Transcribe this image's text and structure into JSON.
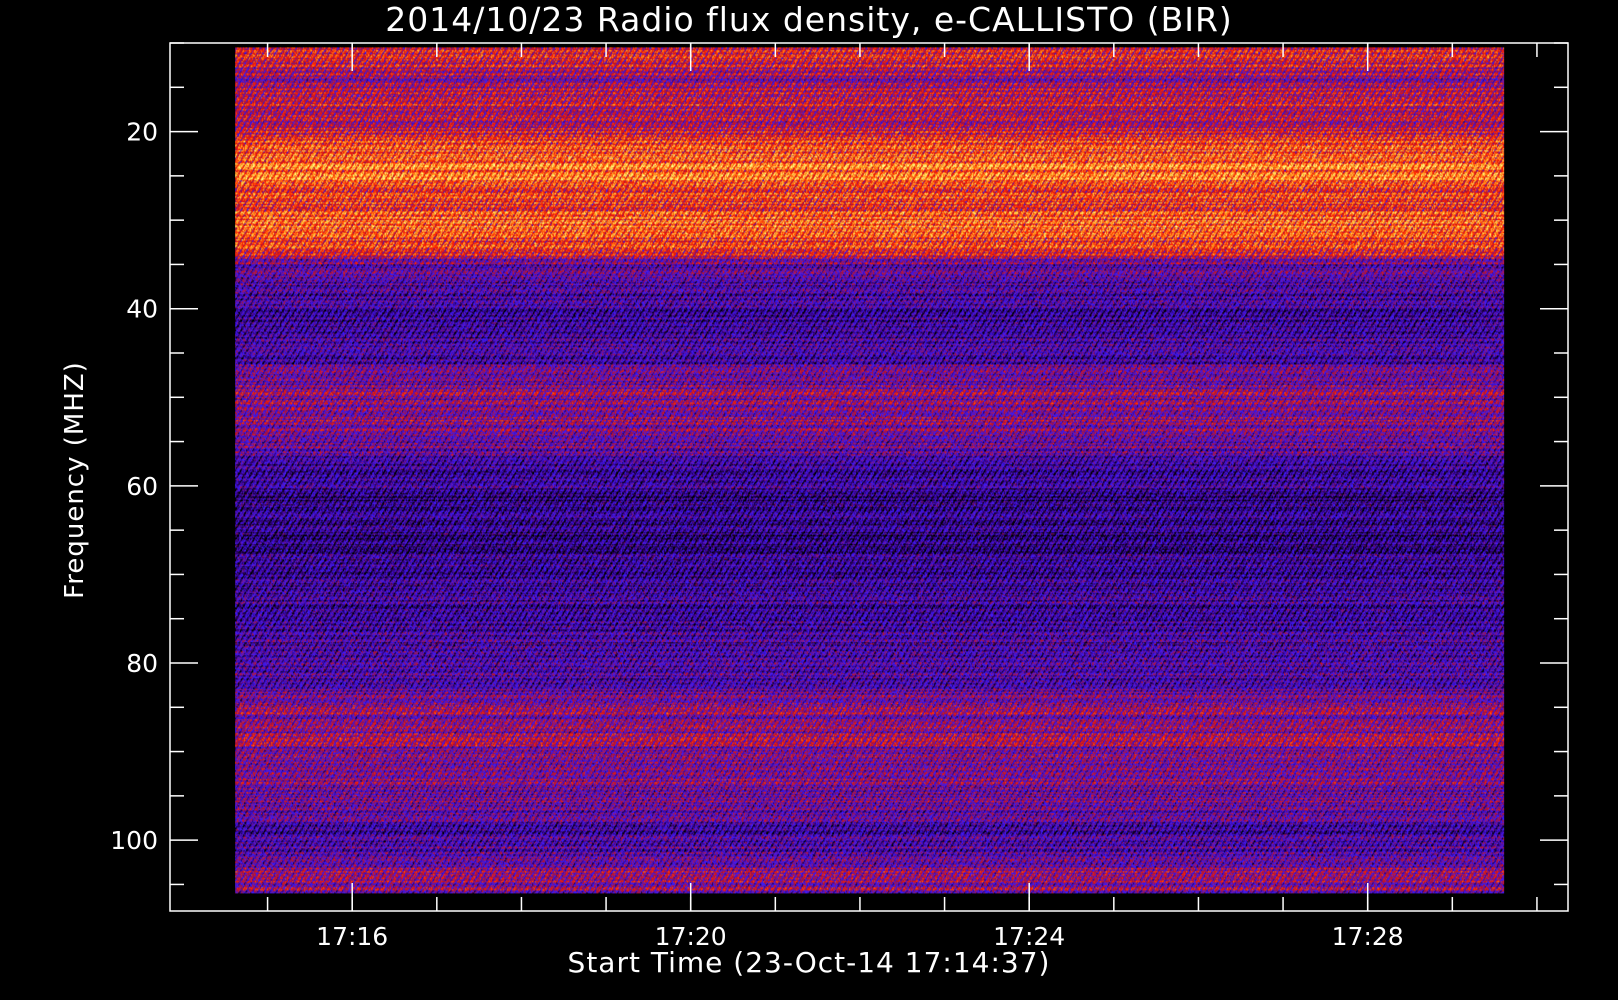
{
  "chart_data": {
    "type": "heatmap",
    "title": "2014/10/23  Radio flux density, e-CALLISTO (BIR)",
    "xlabel": "Start Time (23-Oct-14 17:14:37)",
    "ylabel": "Frequency (MHZ)",
    "x_tick_labels": [
      "17:16",
      "17:20",
      "17:24",
      "17:28"
    ],
    "x_tick_minutes": [
      1.383,
      5.383,
      9.383,
      13.383
    ],
    "x_range_minutes_from_start": [
      -0.77,
      15.75
    ],
    "data_time_range_minutes_from_start": [
      0.0,
      15.0
    ],
    "y_tick_values": [
      20,
      40,
      60,
      80,
      100
    ],
    "y_range": [
      10,
      108
    ],
    "y_reversed": true,
    "data_freq_range": [
      10.5,
      106
    ],
    "colormap": [
      "#000000",
      "#3a0080",
      "#3a1cff",
      "#a01040",
      "#ff2000",
      "#ffa020",
      "#ffff80"
    ],
    "intensity_profile": [
      {
        "freq": 10,
        "level": 0.55
      },
      {
        "freq": 12,
        "level": 0.6
      },
      {
        "freq": 14,
        "level": 0.45
      },
      {
        "freq": 17,
        "level": 0.6
      },
      {
        "freq": 19,
        "level": 0.5
      },
      {
        "freq": 22,
        "level": 0.72
      },
      {
        "freq": 25,
        "level": 0.78
      },
      {
        "freq": 27,
        "level": 0.65
      },
      {
        "freq": 30,
        "level": 0.75
      },
      {
        "freq": 33,
        "level": 0.7
      },
      {
        "freq": 35,
        "level": 0.35
      },
      {
        "freq": 38,
        "level": 0.28
      },
      {
        "freq": 42,
        "level": 0.25
      },
      {
        "freq": 46,
        "level": 0.3
      },
      {
        "freq": 49,
        "level": 0.45
      },
      {
        "freq": 52,
        "level": 0.48
      },
      {
        "freq": 55,
        "level": 0.42
      },
      {
        "freq": 58,
        "level": 0.22
      },
      {
        "freq": 65,
        "level": 0.2
      },
      {
        "freq": 72,
        "level": 0.24
      },
      {
        "freq": 78,
        "level": 0.26
      },
      {
        "freq": 82,
        "level": 0.3
      },
      {
        "freq": 85,
        "level": 0.45
      },
      {
        "freq": 89,
        "level": 0.47
      },
      {
        "freq": 93,
        "level": 0.44
      },
      {
        "freq": 96,
        "level": 0.4
      },
      {
        "freq": 99,
        "level": 0.3
      },
      {
        "freq": 102,
        "level": 0.35
      },
      {
        "freq": 104,
        "level": 0.5
      },
      {
        "freq": 106,
        "level": 0.42
      }
    ],
    "grid": false,
    "legend": "none"
  }
}
